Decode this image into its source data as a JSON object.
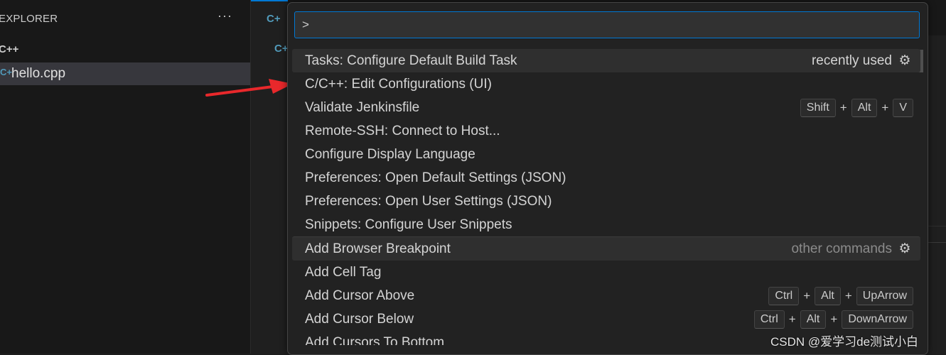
{
  "sidebar": {
    "title": "EXPLORER",
    "more": "···",
    "folder": "C++",
    "file_icon": "C+",
    "file_name": "hello.cpp"
  },
  "editor": {
    "tab_icon": "C+",
    "crumb_icon": "C+"
  },
  "palette": {
    "input_value": ">",
    "items": [
      {
        "label": "Tasks: Configure Default Build Task",
        "hint": "recently used",
        "gear": "⚙"
      },
      {
        "label": "C/C++: Edit Configurations (UI)"
      },
      {
        "label": "Validate Jenkinsfile",
        "keys": [
          "Shift",
          "Alt",
          "V"
        ],
        "plus": "+"
      },
      {
        "label": "Remote-SSH: Connect to Host..."
      },
      {
        "label": "Configure Display Language"
      },
      {
        "label": "Preferences: Open Default Settings (JSON)"
      },
      {
        "label": "Preferences: Open User Settings (JSON)"
      },
      {
        "label": "Snippets: Configure User Snippets"
      },
      {
        "label": "Add Browser Breakpoint",
        "hint": "other commands",
        "gear": "⚙"
      },
      {
        "label": "Add Cell Tag"
      },
      {
        "label": "Add Cursor Above",
        "keys": [
          "Ctrl",
          "Alt",
          "UpArrow"
        ]
      },
      {
        "label": "Add Cursor Below",
        "keys": [
          "Ctrl",
          "Alt",
          "DownArrow"
        ]
      },
      {
        "label": "Add Cursors To Bottom"
      }
    ]
  },
  "watermark": "CSDN @爱学习de测试小白",
  "colors": {
    "accent": "#0078d4",
    "annotation_arrow": "#e8282b",
    "cpp_icon": "#519aba"
  }
}
